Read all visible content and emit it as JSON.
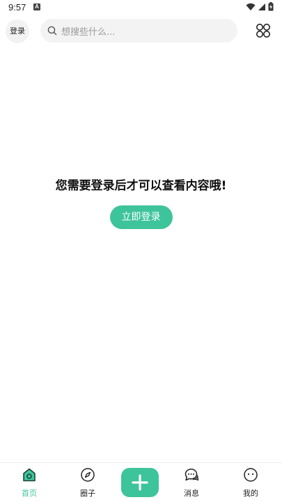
{
  "status_bar": {
    "time": "9:57",
    "notification_glyph": "A",
    "icons": [
      "wifi-icon",
      "cellular-signal-icon",
      "battery-charging-icon"
    ]
  },
  "header": {
    "login_label": "登录",
    "search_placeholder": "想搜些什么...",
    "search_icon": "search-icon",
    "menu_icon": "grid-menu-icon"
  },
  "main": {
    "message": "您需要登录后才可以查看内容哦!",
    "login_button_label": "立即登录"
  },
  "bottom_nav": {
    "items": [
      {
        "label": "首页",
        "icon": "home-icon",
        "active": true
      },
      {
        "label": "圈子",
        "icon": "compass-icon",
        "active": false
      },
      {
        "label": "消息",
        "icon": "chat-bubbles-icon",
        "active": false
      },
      {
        "label": "我的",
        "icon": "profile-face-icon",
        "active": false
      }
    ],
    "post_icon": "plus-icon"
  },
  "colors": {
    "accent": "#3ec49a",
    "search_bg": "#f3f3f3",
    "placeholder": "#9a9a9a"
  }
}
